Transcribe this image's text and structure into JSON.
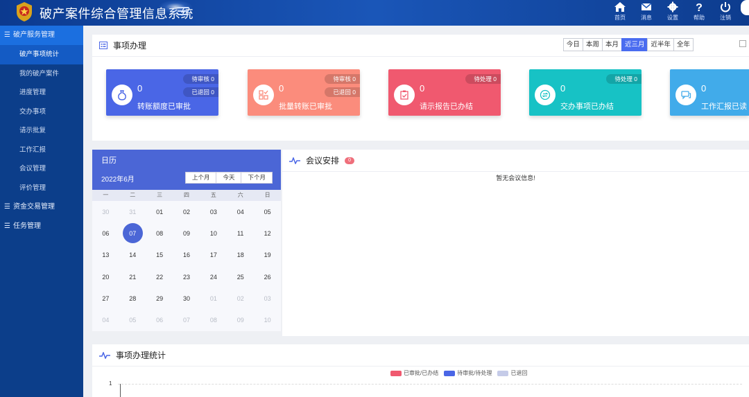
{
  "header": {
    "title": "破产案件综合管理信息系统",
    "nav": [
      {
        "label": "首页",
        "icon": "home-icon"
      },
      {
        "label": "消息",
        "icon": "mail-icon"
      },
      {
        "label": "设置",
        "icon": "gear-icon"
      },
      {
        "label": "帮助",
        "icon": "help-icon"
      },
      {
        "label": "注销",
        "icon": "power-icon"
      }
    ]
  },
  "sidebar": {
    "group1": "破产服务管理",
    "items": [
      "破产事项统计",
      "我的破产案件",
      "进度管理",
      "交办事项",
      "请示批复",
      "工作汇报",
      "会议管理",
      "评价管理"
    ],
    "group2": "资金交易管理",
    "group3": "任务管理"
  },
  "tasks": {
    "title": "事项办理",
    "ranges": [
      "今日",
      "本周",
      "本月",
      "近三月",
      "近半年",
      "全年"
    ],
    "active_range": "近三月",
    "stats": [
      {
        "value": "0",
        "label": "转账额度已审批",
        "pill1": "待审核 0",
        "pill2": "已退回 0",
        "color": "#4a66e6",
        "icon": "money-bag-icon"
      },
      {
        "value": "0",
        "label": "批量转账已审批",
        "pill1": "待审核 0",
        "pill2": "已退回 0",
        "color": "#fb8c7c",
        "icon": "grid-check-icon"
      },
      {
        "value": "0",
        "label": "请示报告已办结",
        "pill1": "待处理 0",
        "color": "#f0596f",
        "icon": "clipboard-check-icon"
      },
      {
        "value": "0",
        "label": "交办事项已办结",
        "pill1": "待处理 0",
        "color": "#17c2c5",
        "icon": "exchange-icon"
      },
      {
        "value": "0",
        "label": "工作汇报已读",
        "color": "#41abea",
        "icon": "chat-icon"
      }
    ]
  },
  "calendar": {
    "title": "日历",
    "month": "2022年6月",
    "buttons": [
      "上个月",
      "今天",
      "下个月"
    ],
    "weekdays": [
      "一",
      "二",
      "三",
      "四",
      "五",
      "六",
      "日"
    ],
    "days": [
      {
        "d": "30",
        "m": true
      },
      {
        "d": "31",
        "m": true
      },
      {
        "d": "01"
      },
      {
        "d": "02"
      },
      {
        "d": "03"
      },
      {
        "d": "04"
      },
      {
        "d": "05"
      },
      {
        "d": "06"
      },
      {
        "d": "07",
        "today": true
      },
      {
        "d": "08"
      },
      {
        "d": "09"
      },
      {
        "d": "10"
      },
      {
        "d": "11"
      },
      {
        "d": "12"
      },
      {
        "d": "13"
      },
      {
        "d": "14"
      },
      {
        "d": "15"
      },
      {
        "d": "16"
      },
      {
        "d": "17"
      },
      {
        "d": "18"
      },
      {
        "d": "19"
      },
      {
        "d": "20"
      },
      {
        "d": "21"
      },
      {
        "d": "22"
      },
      {
        "d": "23"
      },
      {
        "d": "24"
      },
      {
        "d": "25"
      },
      {
        "d": "26"
      },
      {
        "d": "27"
      },
      {
        "d": "28"
      },
      {
        "d": "29"
      },
      {
        "d": "30"
      },
      {
        "d": "01",
        "m": true
      },
      {
        "d": "02",
        "m": true
      },
      {
        "d": "03",
        "m": true
      },
      {
        "d": "04",
        "m": true
      },
      {
        "d": "05",
        "m": true
      },
      {
        "d": "06",
        "m": true
      },
      {
        "d": "07",
        "m": true
      },
      {
        "d": "08",
        "m": true
      },
      {
        "d": "09",
        "m": true
      },
      {
        "d": "10",
        "m": true
      }
    ]
  },
  "meeting": {
    "title": "会议安排",
    "count": "0",
    "empty": "暂无会议信息!"
  },
  "stats_chart": {
    "title": "事项办理统计",
    "legend": [
      {
        "label": "已审批/已办结",
        "color": "#f0596f"
      },
      {
        "label": "待审批/待处理",
        "color": "#4a66e6"
      },
      {
        "label": "已退回",
        "color": "#c5cbe8"
      }
    ],
    "y_tick": "1"
  }
}
